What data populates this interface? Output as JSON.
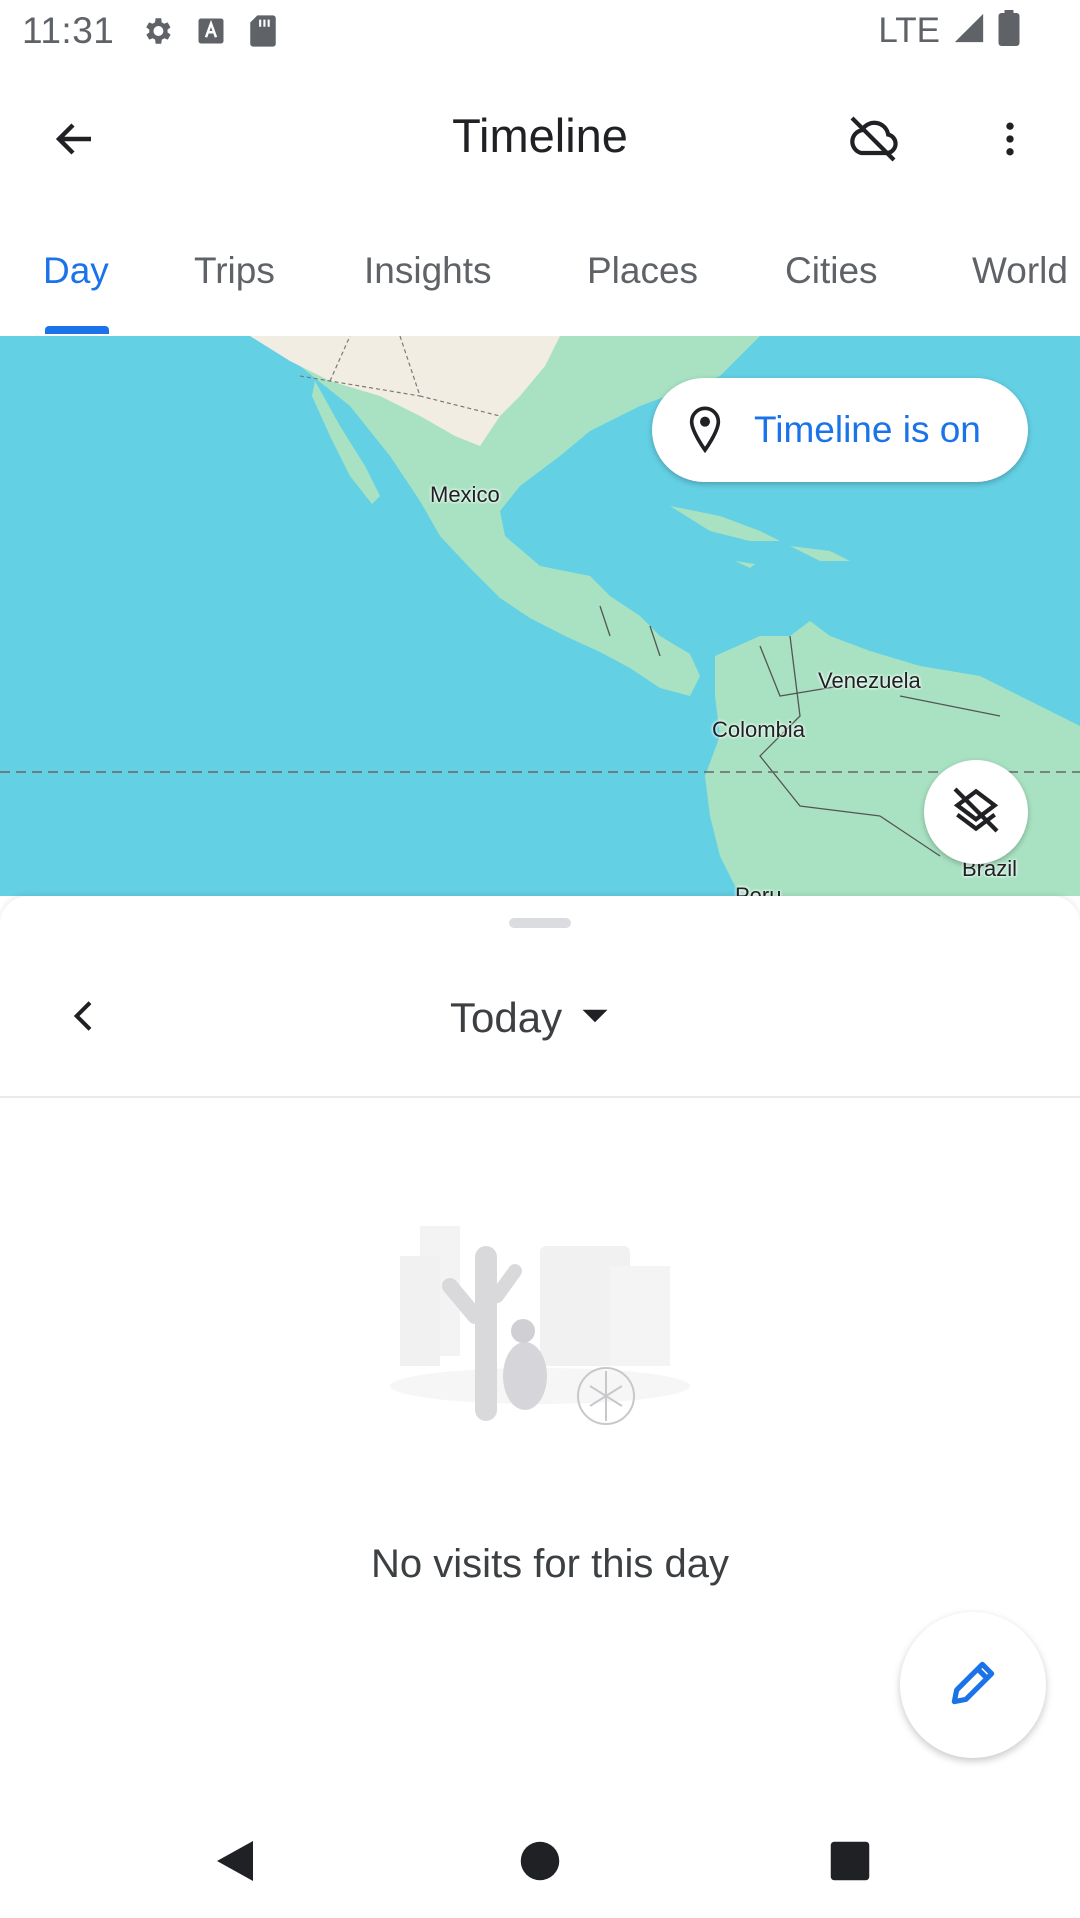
{
  "status_bar": {
    "time": "11:31",
    "network": "LTE",
    "icons": [
      "settings-icon",
      "font-icon",
      "sd-card-icon",
      "signal-icon",
      "battery-icon"
    ]
  },
  "app_bar": {
    "title": "Timeline",
    "icons": [
      "back-arrow-icon",
      "cloud-off-icon",
      "more-vert-icon"
    ]
  },
  "tabs": [
    {
      "label": "Day",
      "active": true
    },
    {
      "label": "Trips",
      "active": false
    },
    {
      "label": "Insights",
      "active": false
    },
    {
      "label": "Places",
      "active": false
    },
    {
      "label": "Cities",
      "active": false
    },
    {
      "label": "World",
      "active": false
    }
  ],
  "map": {
    "chip_label": "Timeline is on",
    "labels": {
      "mexico": "Mexico",
      "venezuela": "Venezuela",
      "colombia": "Colombia",
      "brazil": "Brazil",
      "peru": "Peru"
    },
    "colors": {
      "water": "#64d0e4",
      "land": "#a8e2c2",
      "land_north": "#f2ede3"
    }
  },
  "sheet": {
    "date_label": "Today",
    "empty_message": "No visits for this day"
  },
  "colors": {
    "accent": "#1a73e8",
    "text": "#202124",
    "muted": "#5f6368"
  }
}
